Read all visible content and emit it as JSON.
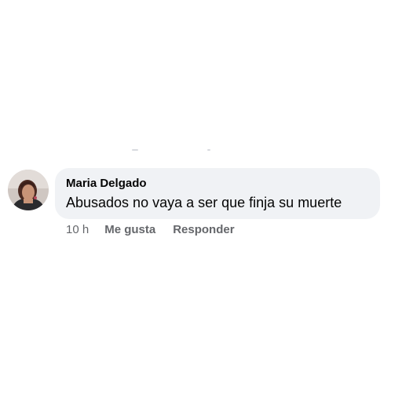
{
  "comment": {
    "author": "Maria Delgado",
    "text": "Abusados no vaya a ser que finja su muerte",
    "avatar_icon": "user-avatar-photo"
  },
  "actions": {
    "timestamp": "10 h",
    "like_label": "Me gusta",
    "reply_label": "Responder"
  },
  "colors": {
    "bubble_background": "#f0f2f5",
    "text": "#050505",
    "secondary_text": "#65676b"
  }
}
